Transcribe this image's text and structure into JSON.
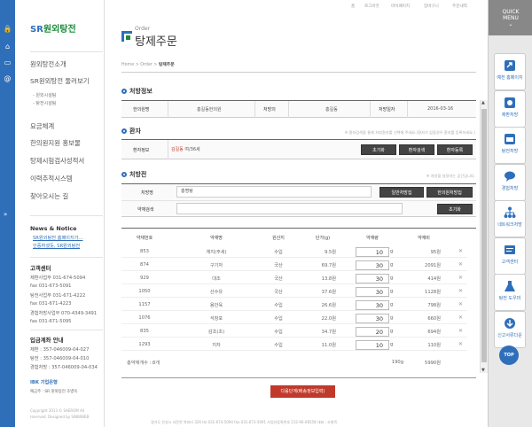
{
  "top_links": [
    "홈",
    "로그아웃",
    "마이페이지",
    "장바구니",
    "주문내역"
  ],
  "logo": {
    "prefix": "SR",
    "name": "원외탕전"
  },
  "nav": {
    "items": [
      "원외탕전소개",
      "SR원외탕전 둘러보기",
      "요금체계",
      "한의원지원 홍보물",
      "탕제시험검사성적서",
      "이력추적시스템",
      "찾아오시는 길"
    ],
    "subs": [
      "- 원외시설팀",
      "- 탕전시설팀"
    ]
  },
  "news": {
    "title": "News & Notice",
    "items": [
      "SR원외탕전 홈페이지가...",
      "인증하셨듯, SR원외탕전"
    ]
  },
  "customer": {
    "title": "고객센터",
    "lines": [
      "제환사업부 031-674-5094",
      "fax 031-673-5091",
      "탕전사업부 031-671-4222",
      "fax 031-671-4223",
      "경험처방사업부 070-4349-3491",
      "fax 031-671-5095"
    ]
  },
  "bank": {
    "title": "입금계좌 안내",
    "lines": [
      "제환 : 357-046009-04-027",
      "탕전 : 357-046009-04-010",
      "경험처방 : 357-046009-04-034"
    ],
    "bank_name": "IBK 기업은행",
    "holder": "예금주 : SR 원외탕전 조병옥"
  },
  "copyright": [
    "Copyright 2013 © SAEROM All",
    "reserved. Designed by SINBIWEB"
  ],
  "page": {
    "title_en": "Order",
    "title_ko": "탕제주문",
    "crumb": [
      "Home",
      "Order",
      "탕제주문"
    ]
  },
  "prescription_info": {
    "section": "처방정보",
    "fields": [
      {
        "label": "한의원명",
        "value": "홍길동한의원"
      },
      {
        "label": "처방의",
        "value": "홍길동"
      },
      {
        "label": "처방일자",
        "value": "2016-03-16"
      }
    ]
  },
  "patient": {
    "section": "환자",
    "note": "※ 환자검색을 통해 처방환자를 선택해 주세요.(환자가 없을경우 환자를 등록하세요.)",
    "label": "환자정보",
    "name": "김길동",
    "info": " 여/36세",
    "buttons": [
      "초기화",
      "환자검색",
      "환자등록"
    ]
  },
  "prescription": {
    "section": "처방전",
    "note": "※ 처방을 설정하는 공간입니다.",
    "name_label": "처방명",
    "name_value": "총명탕",
    "search_label": "약재검색",
    "search_placeholder": "",
    "buttons": [
      "일반처방집",
      "한의원처방집",
      "초기화"
    ]
  },
  "table": {
    "headers": [
      "약재번호",
      "약재명",
      "원산지",
      "단가(g)",
      "약재량",
      "약재비"
    ],
    "rows": [
      {
        "code": "853",
        "name": "계지(주세)",
        "origin": "수입",
        "price": "9.5원",
        "qty": "10",
        "cost": "95원"
      },
      {
        "code": "874",
        "name": "구기자",
        "origin": "국산",
        "price": "69.7원",
        "qty": "30",
        "cost": "2091원"
      },
      {
        "code": "929",
        "name": "대조",
        "origin": "국산",
        "price": "13.8원",
        "qty": "30",
        "cost": "414원"
      },
      {
        "code": "1050",
        "name": "산수유",
        "origin": "국산",
        "price": "37.6원",
        "qty": "30",
        "cost": "1128원"
      },
      {
        "code": "1157",
        "name": "용안육",
        "origin": "수입",
        "price": "26.6원",
        "qty": "30",
        "cost": "798원"
      },
      {
        "code": "1076",
        "name": "석창포",
        "origin": "수입",
        "price": "22.0원",
        "qty": "30",
        "cost": "660원"
      },
      {
        "code": "835",
        "name": "감초(초)",
        "origin": "수입",
        "price": "34.7원",
        "qty": "20",
        "cost": "694원"
      },
      {
        "code": "1293",
        "name": "지자",
        "origin": "수입",
        "price": "11.0원",
        "qty": "10",
        "cost": "110원"
      }
    ],
    "total_label": "총약재개수 : 8개",
    "total_qty": "190g",
    "total_cost": "5990원"
  },
  "next_button": "다음단계(배송정보입력)",
  "footer": "경기도 안성시 서운면 북좌리 326 tel.031-674-5094 fax.031-673-5091 사업자등록번호 212-90-06558 대표 : 조병옥",
  "quick": {
    "title": [
      "QUICK",
      "MENU"
    ],
    "items": [
      "예전 홈페이지",
      "제환처방",
      "탕전처방",
      "경험처방",
      "네트워크처방",
      "고객센터",
      "탕전 도우미",
      "신고서류다운"
    ],
    "top": "TOP"
  },
  "colors": {
    "accent": "#2f6fba",
    "next_button": "#c0392b",
    "logo_green": "#1b8c3b"
  }
}
